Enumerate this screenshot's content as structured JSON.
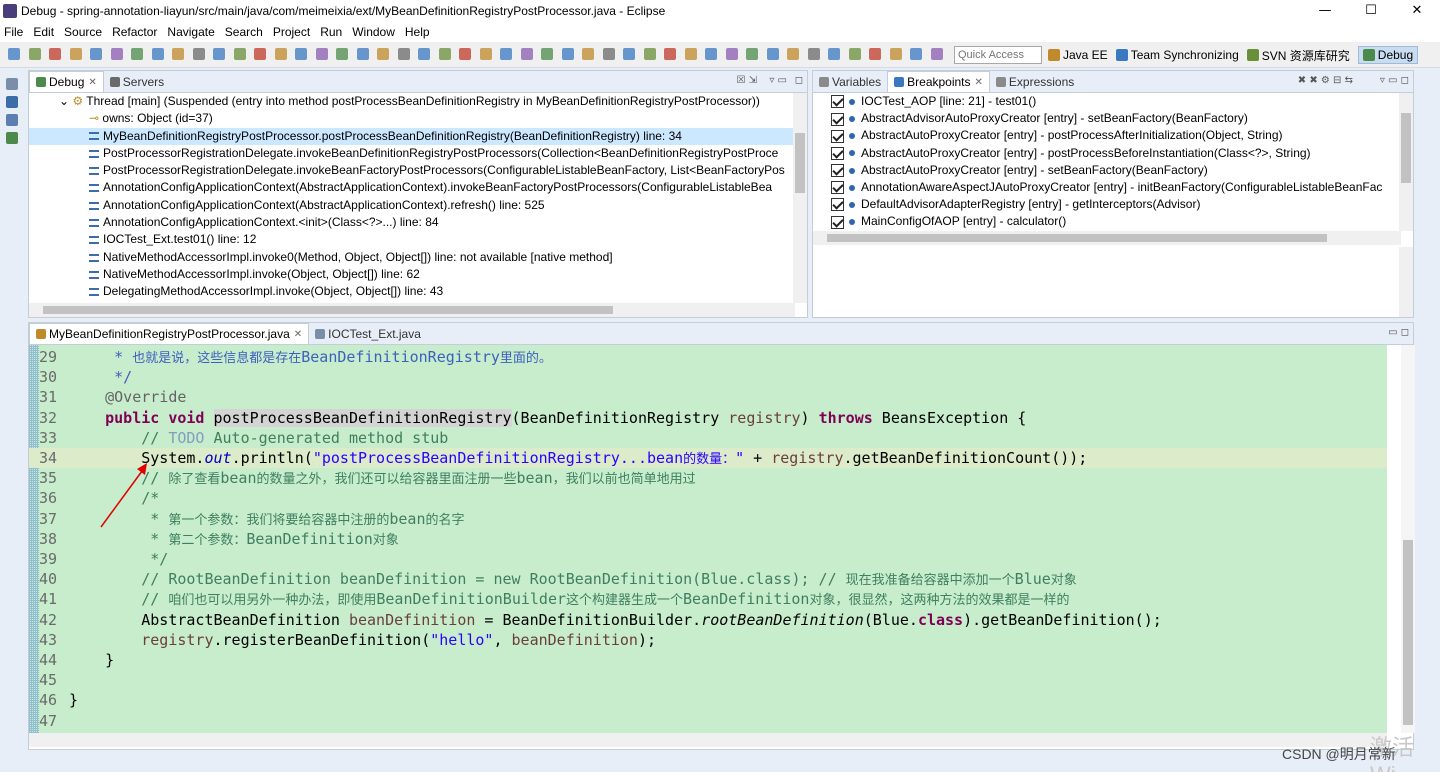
{
  "window": {
    "title": "Debug - spring-annotation-liayun/src/main/java/com/meimeixia/ext/MyBeanDefinitionRegistryPostProcessor.java - Eclipse",
    "minimize": "—",
    "maximize": "☐",
    "close": "✕"
  },
  "menu": [
    "File",
    "Edit",
    "Source",
    "Refactor",
    "Navigate",
    "Search",
    "Project",
    "Run",
    "Window",
    "Help"
  ],
  "quick_access": {
    "placeholder": "Quick Access"
  },
  "perspectives": [
    {
      "label": "Java EE",
      "color": "#c08a2c"
    },
    {
      "label": "Team Synchronizing",
      "color": "#3a78c2"
    },
    {
      "label": "SVN 资源库研究",
      "color": "#6a8f3a"
    },
    {
      "label": "Debug",
      "color": "#4b8a4b",
      "active": true
    }
  ],
  "debug_view": {
    "tabs": [
      {
        "label": "Debug",
        "active": true
      },
      {
        "label": "Servers",
        "active": false
      }
    ],
    "rows": [
      {
        "text": "Thread [main] (Suspended (entry into method postProcessBeanDefinitionRegistry in MyBeanDefinitionRegistryPostProcessor))",
        "indent": 58,
        "type": "thread"
      },
      {
        "text": "owns: Object  (id=37)",
        "indent": 88,
        "type": "owns"
      },
      {
        "text": "MyBeanDefinitionRegistryPostProcessor.postProcessBeanDefinitionRegistry(BeanDefinitionRegistry) line: 34",
        "indent": 88,
        "type": "frame",
        "selected": true
      },
      {
        "text": "PostProcessorRegistrationDelegate.invokeBeanDefinitionRegistryPostProcessors(Collection<BeanDefinitionRegistryPostProce",
        "indent": 88,
        "type": "frame"
      },
      {
        "text": "PostProcessorRegistrationDelegate.invokeBeanFactoryPostProcessors(ConfigurableListableBeanFactory, List<BeanFactoryPos",
        "indent": 88,
        "type": "frame"
      },
      {
        "text": "AnnotationConfigApplicationContext(AbstractApplicationContext).invokeBeanFactoryPostProcessors(ConfigurableListableBea",
        "indent": 88,
        "type": "frame"
      },
      {
        "text": "AnnotationConfigApplicationContext(AbstractApplicationContext).refresh() line: 525",
        "indent": 88,
        "type": "frame"
      },
      {
        "text": "AnnotationConfigApplicationContext.<init>(Class<?>...) line: 84",
        "indent": 88,
        "type": "frame"
      },
      {
        "text": "IOCTest_Ext.test01() line: 12",
        "indent": 88,
        "type": "frame"
      },
      {
        "text": "NativeMethodAccessorImpl.invoke0(Method, Object, Object[]) line: not available [native method]",
        "indent": 88,
        "type": "frame"
      },
      {
        "text": "NativeMethodAccessorImpl.invoke(Object, Object[]) line: 62",
        "indent": 88,
        "type": "frame"
      },
      {
        "text": "DelegatingMethodAccessorImpl.invoke(Object, Object[]) line: 43",
        "indent": 88,
        "type": "frame"
      }
    ]
  },
  "breakpoints_view": {
    "tabs": [
      {
        "label": "Variables",
        "active": false
      },
      {
        "label": "Breakpoints",
        "active": true
      },
      {
        "label": "Expressions",
        "active": false
      }
    ],
    "rows": [
      "IOCTest_AOP [line: 21] - test01()",
      "AbstractAdvisorAutoProxyCreator [entry] - setBeanFactory(BeanFactory)",
      "AbstractAutoProxyCreator [entry] - postProcessAfterInitialization(Object, String)",
      "AbstractAutoProxyCreator [entry] - postProcessBeforeInstantiation(Class<?>, String)",
      "AbstractAutoProxyCreator [entry] - setBeanFactory(BeanFactory)",
      "AnnotationAwareAspectJAutoProxyCreator [entry] - initBeanFactory(ConfigurableListableBeanFac",
      "DefaultAdvisorAdapterRegistry [entry] - getInterceptors(Advisor)",
      "MainConfigOfAOP [entry] - calculator()"
    ]
  },
  "editor": {
    "tabs": [
      {
        "label": "MyBeanDefinitionRegistryPostProcessor.java",
        "active": true
      },
      {
        "label": "IOCTest_Ext.java",
        "active": false
      }
    ],
    "lines": [
      {
        "n": "29",
        "html": "<span class='jd'>     * </span><span class='jdj'>也就是说，这些信息都是存在</span><span class='jd'>BeanDefinitionRegistry</span><span class='jdj'>里面的。</span>"
      },
      {
        "n": "30",
        "html": "<span class='jd'>     */</span>"
      },
      {
        "n": "31",
        "html": "    <span class='ann'>@Override</span>"
      },
      {
        "n": "32",
        "html": "    <span class='kw'>public</span> <span class='kw'>void</span> <span class='hlword'>postProcessBeanDefinitionRegistry</span>(BeanDefinitionRegistry <span class='var'>registry</span>) <span class='kw'>throws</span> BeansException {"
      },
      {
        "n": "33",
        "html": "        <span class='cm'>// </span><span class='todo'>TODO</span><span class='cm'> Auto-generated method stub</span>"
      },
      {
        "n": "34",
        "html": "        System.<span class='fld'>out</span>.println(<span class='str'>\"postProcessBeanDefinitionRegistry...bean</span><span class='strj'>的数量：</span><span class='str'>\"</span> + <span class='var'>registry</span>.getBeanDefinitionCount());",
        "hl": true
      },
      {
        "n": "35",
        "html": "        <span class='cm'>// </span><span class='cmj'>除了查看</span><span class='cm'>bean</span><span class='cmj'>的数量之外，我们还可以给容器里面注册一些</span><span class='cm'>bean</span><span class='cmj'>，我们以前也简单地用过</span>"
      },
      {
        "n": "36",
        "html": "        <span class='cm'>/*</span>"
      },
      {
        "n": "37",
        "html": "<span class='cm'>         * </span><span class='cmj'>第一个参数：我们将要给容器中注册的</span><span class='cm'>bean</span><span class='cmj'>的名字</span>"
      },
      {
        "n": "38",
        "html": "<span class='cm'>         * </span><span class='cmj'>第二个参数：</span><span class='cm'>BeanDefinition</span><span class='cmj'>对象</span>"
      },
      {
        "n": "39",
        "html": "<span class='cm'>         */</span>"
      },
      {
        "n": "40",
        "html": "        <span class='cm'>// RootBeanDefinition beanDefinition = new RootBeanDefinition(Blue.class); // </span><span class='cmj'>现在我准备给容器中添加一个</span><span class='cm'>Blue</span><span class='cmj'>对象</span>"
      },
      {
        "n": "41",
        "html": "        <span class='cm'>// </span><span class='cmj'>咱们也可以用另外一种办法，即使用</span><span class='cm'>BeanDefinitionBuilder</span><span class='cmj'>这个构建器生成一个</span><span class='cm'>BeanDefinition</span><span class='cmj'>对象，很显然，这两种方法的效果都是一样的</span>"
      },
      {
        "n": "42",
        "html": "        AbstractBeanDefinition <span class='var'>beanDefinition</span> = BeanDefinitionBuilder.<span class='ital'>rootBeanDefinition</span>(Blue.<span class='kw'>class</span>).getBeanDefinition();"
      },
      {
        "n": "43",
        "html": "        <span class='var'>registry</span>.registerBeanDefinition(<span class='str'>\"hello\"</span>, <span class='var'>beanDefinition</span>);"
      },
      {
        "n": "44",
        "html": "    }"
      },
      {
        "n": "45",
        "html": ""
      },
      {
        "n": "46",
        "html": "}"
      },
      {
        "n": "47",
        "html": ""
      }
    ]
  },
  "watermark": "CSDN @明月常新",
  "watermark_faint": "激活 Wi"
}
